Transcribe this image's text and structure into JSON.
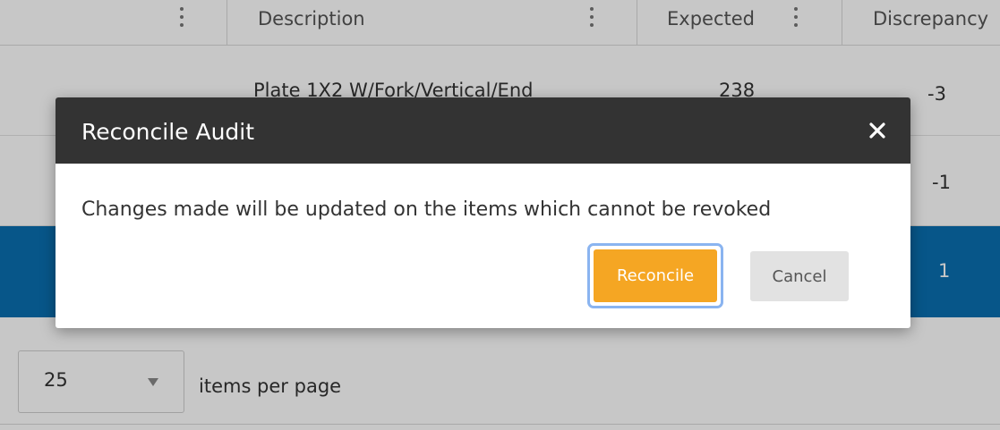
{
  "grid": {
    "columns": [
      {
        "label": ""
      },
      {
        "label": "Description"
      },
      {
        "label": "Expected"
      },
      {
        "label": "Discrepancy"
      }
    ],
    "rows": [
      {
        "description": "Plate 1X2 W/Fork/Vertical/End",
        "expected": "238",
        "discrepancy": "-3",
        "selected": false
      },
      {
        "description": "",
        "expected": "",
        "discrepancy": "-1",
        "selected": false
      },
      {
        "description": "",
        "expected": "",
        "discrepancy": "1",
        "selected": true
      }
    ]
  },
  "pager": {
    "page_size": "25",
    "label": "items per page"
  },
  "dialog": {
    "title": "Reconcile Audit",
    "message": "Changes made will be updated on the items which cannot be revoked",
    "reconcile_label": "Reconcile",
    "cancel_label": "Cancel"
  },
  "colors": {
    "dialog_title_bg": "#333333",
    "primary_button": "#f5a623",
    "focus_ring": "#8ab4f0",
    "selected_row": "#0a6fb0"
  }
}
